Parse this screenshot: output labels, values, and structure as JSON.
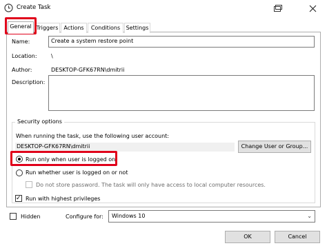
{
  "window": {
    "title": "Create Task",
    "icons": [
      "clock-icon",
      "restore-icon",
      "close-icon"
    ]
  },
  "tabs": [
    {
      "label": "General",
      "active": true
    },
    {
      "label": "Triggers",
      "active": false
    },
    {
      "label": "Actions",
      "active": false
    },
    {
      "label": "Conditions",
      "active": false
    },
    {
      "label": "Settings",
      "active": false
    }
  ],
  "general": {
    "name_label": "Name:",
    "name_value": "Create a system restore point",
    "location_label": "Location:",
    "location_value": "\\",
    "author_label": "Author:",
    "author_value": "DESKTOP-GFK67RN\\dmitrii",
    "description_label": "Description:",
    "description_value": ""
  },
  "security": {
    "group_title": "Security options",
    "account_prompt": "When running the task, use the following user account:",
    "account_value": "DESKTOP-GFK67RN\\dmitrii",
    "change_button": "Change User or Group...",
    "option_logged_on": "Run only when user is logged on",
    "option_whether": "Run whether user is logged on or not",
    "no_store_password": "Do not store password.  The task will only have access to local computer resources.",
    "highest_privileges": "Run with highest privileges"
  },
  "bottom": {
    "hidden_label": "Hidden",
    "configure_label": "Configure for:",
    "configure_value": "Windows 10",
    "ok_button": "OK",
    "cancel_button": "Cancel"
  },
  "colors": {
    "highlight": "#e0001a"
  }
}
